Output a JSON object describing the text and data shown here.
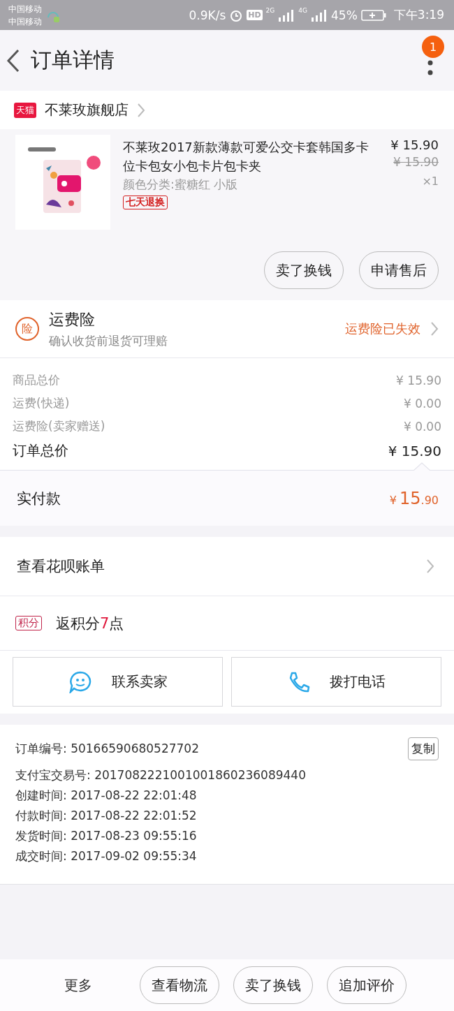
{
  "status_bar": {
    "carriers": [
      "中国移动",
      "中国移动"
    ],
    "speed": "0.9K/s",
    "hd": "HD",
    "net_1": "2G",
    "net_2": "4G",
    "battery": "45%",
    "time": "下午3:19"
  },
  "header": {
    "title": "订单详情",
    "badge": "1"
  },
  "shop": {
    "tag": "天猫",
    "name": "不莱玫旗舰店"
  },
  "product": {
    "kind": "picture",
    "title": "不莱玫2017新款薄款可爱公交卡套韩国多卡位卡包女小包卡片包卡夹",
    "variant": "颜色分类:蜜糖红 小版",
    "tag": "七天退换",
    "price": "¥ 15.90",
    "original_price": "¥ 15.90",
    "quantity": "×1",
    "buttons": [
      "卖了换钱",
      "申请售后"
    ]
  },
  "insurance": {
    "icon_text": "险",
    "title": "运费险",
    "subtitle": "确认收货前退货可理赔",
    "status": "运费险已失效"
  },
  "price_rows": [
    {
      "label": "商品总价",
      "value": "¥ 15.90",
      "kind": "minor"
    },
    {
      "label": "运费(快递)",
      "value": "¥ 0.00",
      "kind": "minor"
    },
    {
      "label": "运费险(卖家赠送)",
      "value": "¥ 0.00",
      "kind": "minor"
    },
    {
      "label": "订单总价",
      "value": "¥ 15.90",
      "kind": "total"
    }
  ],
  "paid": {
    "label": "实付款",
    "currency": "¥",
    "amount": "15",
    "cents": ".90"
  },
  "huabei": {
    "label": "查看花呗账单"
  },
  "points": {
    "tag": "积分",
    "text_before": "返积分",
    "highlight": "7",
    "text_after": "点"
  },
  "contact_buttons": [
    {
      "label": "联系卖家",
      "kind": "chat"
    },
    {
      "label": "拨打电话",
      "kind": "phone"
    }
  ],
  "order_info": {
    "copy_button": "复制",
    "lines": [
      "订单编号: 50166590680527702",
      "支付宝交易号: 2017082221001001860236089440",
      "创建时间: 2017-08-22 22:01:48",
      "付款时间: 2017-08-22 22:01:52",
      "发货时间: 2017-08-23 09:55:16",
      "成交时间: 2017-09-02 09:55:34"
    ]
  },
  "bottom_bar": {
    "more": "更多",
    "buttons": [
      "查看物流",
      "卖了换钱",
      "追加评价"
    ]
  }
}
